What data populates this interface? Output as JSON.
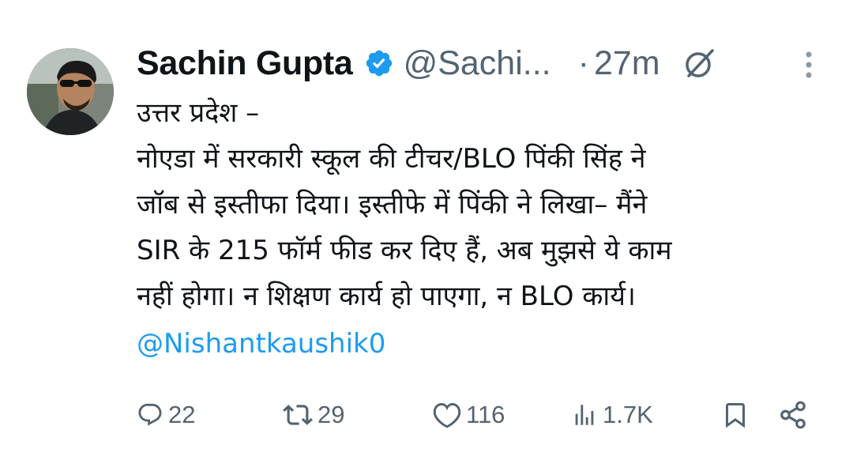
{
  "author": {
    "name": "Sachin Gupta",
    "handle": "@Sachi...",
    "verified": true,
    "verified_color": "#1d9bf0"
  },
  "meta": {
    "separator": "·",
    "time": "27m"
  },
  "icons": {
    "verified": "verified-badge-icon",
    "grok": "grok-icon",
    "more": "more-options-icon",
    "reply": "reply-icon",
    "retweet": "retweet-icon",
    "like": "like-icon",
    "views": "views-icon",
    "bookmark": "bookmark-icon",
    "share": "share-icon"
  },
  "tweet": {
    "lines": [
      "उत्तर प्रदेश –",
      "नोएडा में सरकारी स्कूल की टीचर/BLO पिंकी सिंह ने",
      "जॉब से इस्तीफा दिया। इस्तीफे में पिंकी ने लिखा– मैंने",
      "SIR के 215 फॉर्म फीड कर दिए हैं, अब मुझसे ये काम",
      "नहीं होगा। न शिक्षण कार्य हो पाएगा, न BLO कार्य।"
    ],
    "mention": "@Nishantkaushik0"
  },
  "stats": {
    "replies": "22",
    "retweets": "29",
    "likes": "116",
    "views": "1.7K"
  },
  "colors": {
    "text": "#0f1419",
    "secondary": "#536471",
    "link": "#1d9bf0"
  }
}
